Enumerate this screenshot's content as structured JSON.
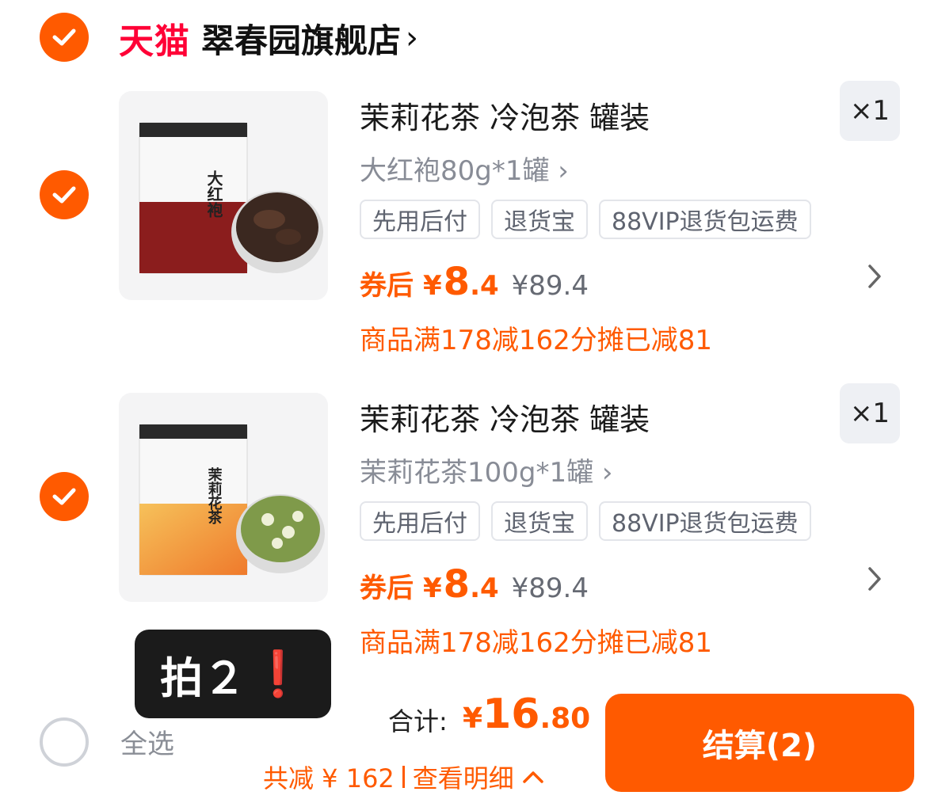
{
  "store": {
    "logo_text": "天猫",
    "name": "翠春园旗舰店",
    "chevron": "›"
  },
  "products": [
    {
      "title": "茉莉花茶 冷泡茶 罐装",
      "qty": "×1",
      "sku": "大红袍80g*1罐 ›",
      "tags": [
        "先用后付",
        "退货宝",
        "88VIP退货包运费"
      ],
      "after_coupon_label": "券后",
      "price_yen": "¥",
      "price_int": "8",
      "price_dec": ".4",
      "orig_price": "¥89.4",
      "promo": "商品满178减162分摊已减81",
      "image_label": "大红袍",
      "image_accent": "#8b1d1d"
    },
    {
      "title": "茉莉花茶 冷泡茶 罐装",
      "qty": "×1",
      "sku": "茉莉花茶100g*1罐 ›",
      "tags": [
        "先用后付",
        "退货宝",
        "88VIP退货包运费"
      ],
      "after_coupon_label": "券后",
      "price_yen": "¥",
      "price_int": "8",
      "price_dec": ".4",
      "orig_price": "¥89.4",
      "promo": "商品满178减162分摊已减81",
      "image_label": "茉莉花茶",
      "image_accent": "#f39a3a"
    }
  ],
  "overlay": {
    "text": "拍２",
    "mark": "❗"
  },
  "footer": {
    "select_all": "全选",
    "total_label": "合计:",
    "total_yen": "¥",
    "total_int": "16",
    "total_dec": ".80",
    "discount": "共减 ¥ 162",
    "detail": "查看明细",
    "detail_chevron": "^",
    "checkout": "结算(2)"
  },
  "colors": {
    "accent": "#ff5a00",
    "tmall": "#ff0036"
  }
}
